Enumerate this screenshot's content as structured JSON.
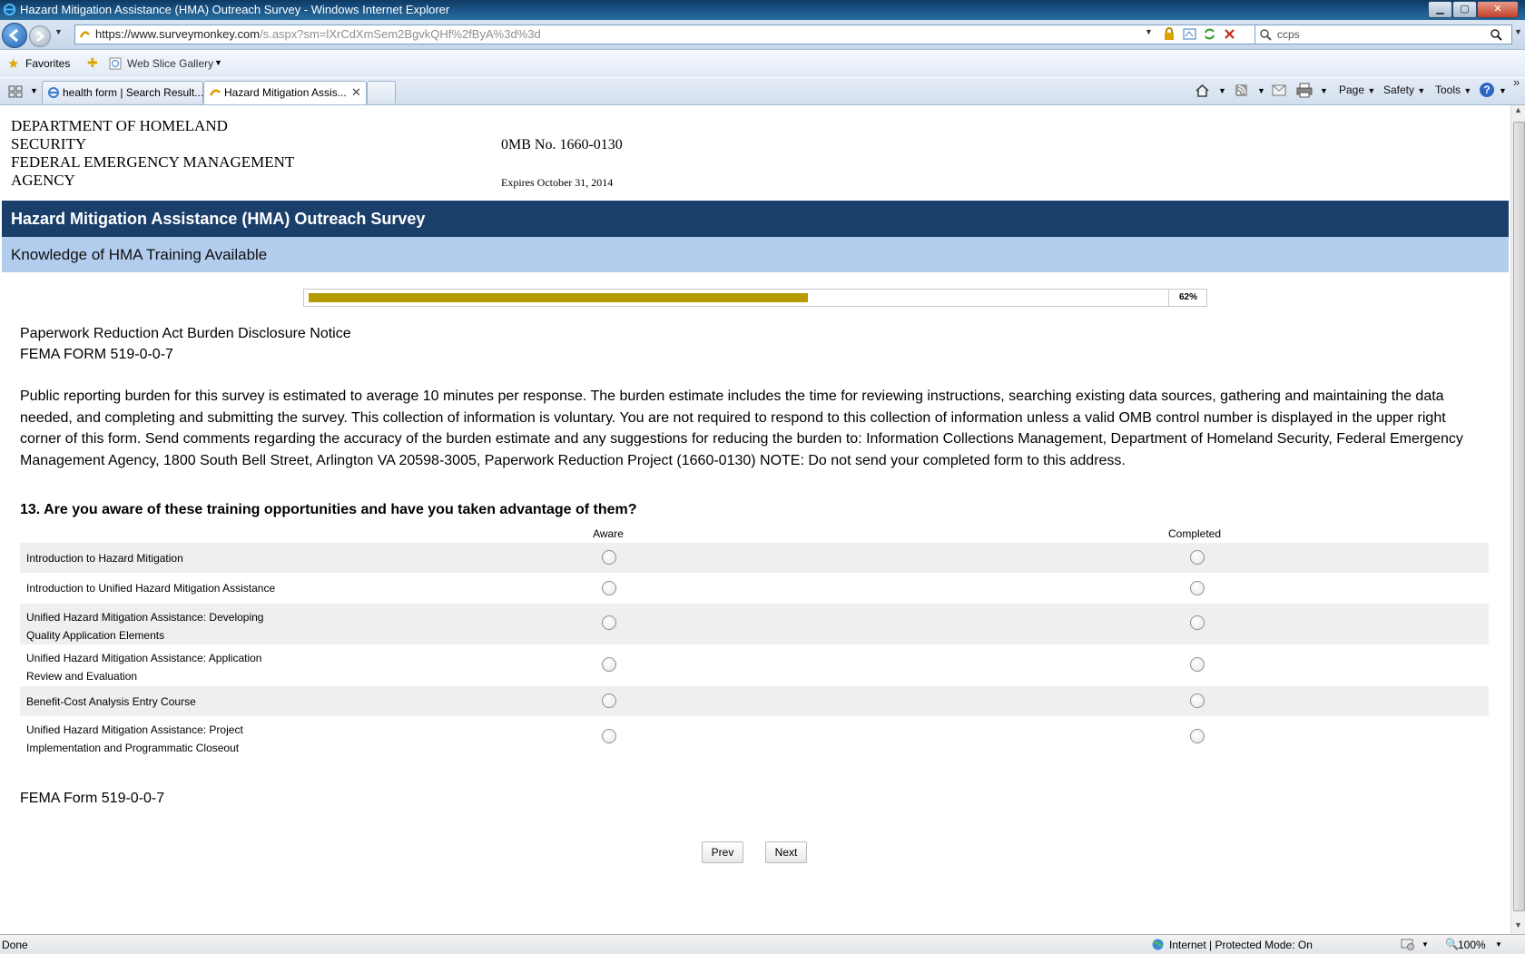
{
  "window": {
    "title": "Hazard Mitigation Assistance (HMA) Outreach Survey - Windows Internet Explorer",
    "min_glyph": "▁",
    "max_glyph": "▢",
    "close_glyph": "✕"
  },
  "address_bar": {
    "url_host": "https://www.surveymonkey.com",
    "url_path": "/s.aspx?sm=lXrCdXmSem2BgvkQHf%2fByA%3d%3d",
    "search_value": "ccps"
  },
  "favorites_bar": {
    "favorites_label": "Favorites",
    "web_slice_label": "Web Slice Gallery"
  },
  "tabs": [
    {
      "label": "health form | Search Result..."
    },
    {
      "label": "Hazard Mitigation Assis..."
    }
  ],
  "command_bar": {
    "page": "Page",
    "safety": "Safety",
    "tools": "Tools"
  },
  "header": {
    "agency_line1": "DEPARTMENT OF HOMELAND",
    "agency_line2": "SECURITY",
    "agency_line3": "FEDERAL EMERGENCY MANAGEMENT",
    "agency_line4": "AGENCY",
    "omb": "0MB No. 1660-0130",
    "expires": "Expires October 31, 2014"
  },
  "survey": {
    "title": "Hazard Mitigation Assistance (HMA) Outreach Survey",
    "page_title": "Knowledge of HMA Training Available",
    "progress_percent": 62,
    "progress_label": "62%",
    "notice_line1": "Paperwork Reduction Act Burden Disclosure Notice",
    "notice_line2": "FEMA FORM 519-0-0-7",
    "burden_text": "Public reporting burden for this survey is estimated to average 10 minutes per response. The burden estimate includes the time for reviewing instructions, searching existing data sources, gathering and maintaining the data needed, and completing and submitting the survey. This collection of information is voluntary. You are not required to respond to this collection of information unless a valid OMB control number is displayed in the upper right corner of this form. Send comments regarding the accuracy of the burden estimate and any suggestions for reducing the burden to: Information Collections Management, Department of Homeland Security, Federal Emergency Management Agency, 1800 South Bell Street, Arlington VA 20598-3005, Paperwork Reduction Project (1660-0130) NOTE: Do not send your completed form to this address.",
    "question": "13. Are you aware of these training opportunities and have you taken advantage of them?",
    "columns": [
      "Aware",
      "Completed"
    ],
    "rows": [
      {
        "line1": "Introduction to Hazard Mitigation",
        "line2": ""
      },
      {
        "line1": "Introduction to Unified Hazard Mitigation Assistance",
        "line2": ""
      },
      {
        "line1": "Unified Hazard Mitigation Assistance: Developing",
        "line2": "Quality Application Elements"
      },
      {
        "line1": "Unified Hazard Mitigation Assistance: Application",
        "line2": "Review and Evaluation"
      },
      {
        "line1": "Benefit-Cost Analysis Entry Course",
        "line2": ""
      },
      {
        "line1": "Unified Hazard Mitigation Assistance: Project",
        "line2": "Implementation and Programmatic Closeout"
      }
    ],
    "footer_form": "FEMA Form 519-0-0-7",
    "prev_label": "Prev",
    "next_label": "Next"
  },
  "status_bar": {
    "status": "Done",
    "zone": "Internet | Protected Mode: On",
    "zoom": "100%"
  },
  "colors": {
    "survey_title_bg": "#1b3f6b",
    "page_title_bg": "#b3cdef",
    "progress_fill": "#b59a00"
  }
}
